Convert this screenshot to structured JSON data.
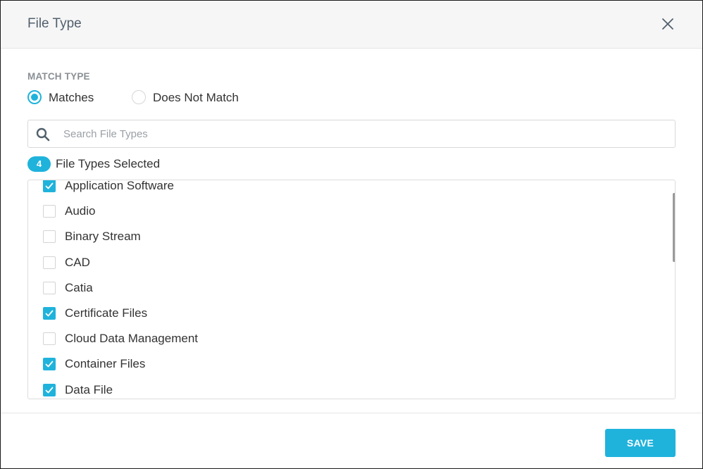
{
  "dialog": {
    "title": "File Type",
    "close_icon": "close-icon"
  },
  "match_type": {
    "label": "MATCH TYPE",
    "options": [
      {
        "label": "Matches",
        "selected": true
      },
      {
        "label": "Does Not Match",
        "selected": false
      }
    ]
  },
  "search": {
    "placeholder": "Search File Types",
    "value": "",
    "icon": "search-icon"
  },
  "selection": {
    "count": "4",
    "label": "File Types Selected"
  },
  "file_types": [
    {
      "label": "Application Software",
      "checked": true
    },
    {
      "label": "Audio",
      "checked": false
    },
    {
      "label": "Binary Stream",
      "checked": false
    },
    {
      "label": "CAD",
      "checked": false
    },
    {
      "label": "Catia",
      "checked": false
    },
    {
      "label": "Certificate Files",
      "checked": true
    },
    {
      "label": "Cloud Data Management",
      "checked": false
    },
    {
      "label": "Container Files",
      "checked": true
    },
    {
      "label": "Data File",
      "checked": true
    }
  ],
  "footer": {
    "save_label": "SAVE"
  },
  "colors": {
    "accent": "#1fb3dc",
    "header_bg": "#f6f6f6",
    "text": "#333333",
    "muted": "#8a8f94"
  }
}
